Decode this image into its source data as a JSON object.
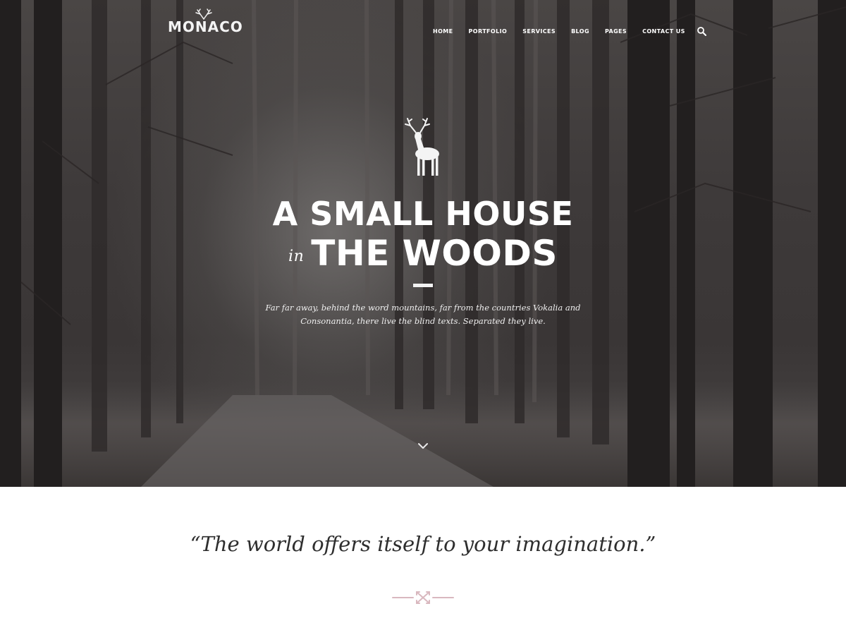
{
  "brand": {
    "name": "MONACO"
  },
  "nav": {
    "items": [
      "HOME",
      "PORTFOLIO",
      "SERVICES",
      "BLOG",
      "PAGES",
      "CONTACT US"
    ],
    "search_icon": "search-icon"
  },
  "hero": {
    "headline_line1": "A SMALL HOUSE",
    "headline_in": "in",
    "headline_line2": "THE WOODS",
    "subtitle_line1": "Far far away, behind the word mountains, far from the countries Vokalia and",
    "subtitle_line2": "Consonantia, there live the blind texts. Separated they live.",
    "deer_icon": "deer-icon",
    "scroll_icon": "chevron-down-icon"
  },
  "quote": {
    "text": "“The world offers itself to your imagination.”",
    "ornament_icon": "crossed-arrows-icon"
  },
  "colors": {
    "hero_overlay": "#3e3a3a",
    "text_light": "#ffffff",
    "quote_text": "#2e2e2e",
    "accent_pink": "#d9b8bf"
  }
}
